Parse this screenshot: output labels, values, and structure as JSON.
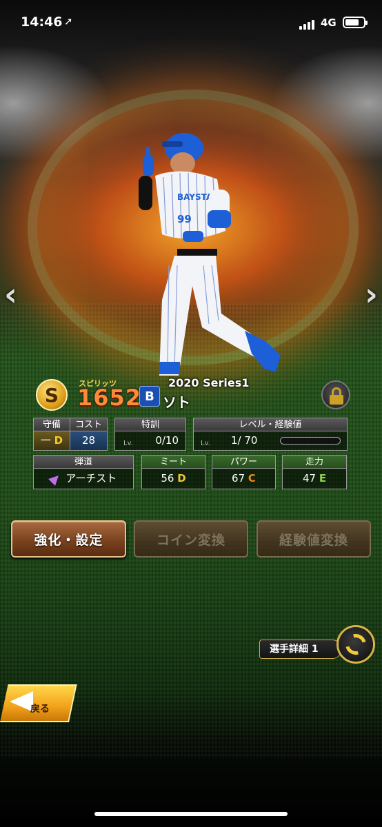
{
  "status_bar": {
    "time": "14:46",
    "network": "4G"
  },
  "card": {
    "rank_letter": "S",
    "spirits_label": "スピリッツ",
    "spirits_value": "1652",
    "team_logo_text": "B",
    "series": "2020 Series1",
    "player_name": "ソト"
  },
  "stats": {
    "defense": {
      "label": "守備",
      "position": "一",
      "grade": "D"
    },
    "cost": {
      "label": "コスト",
      "value": "28"
    },
    "training": {
      "label": "特訓",
      "lv_prefix": "Lv.",
      "value": "0/10"
    },
    "level": {
      "label": "レベル・経験値",
      "lv_prefix": "Lv.",
      "value": "1/ 70",
      "exp_fraction": 0.0
    },
    "trajectory": {
      "label": "弾道",
      "value": "アーチスト"
    },
    "meet": {
      "label": "ミート",
      "value": "56",
      "grade": "D"
    },
    "power": {
      "label": "パワー",
      "value": "67",
      "grade": "C"
    },
    "speed": {
      "label": "走力",
      "value": "47",
      "grade": "E"
    }
  },
  "buttons": {
    "enhance": "強化・設定",
    "coin": "コイン変換",
    "exp": "経験値変換",
    "detail": "選手詳細 1",
    "back": "戻る"
  },
  "icons": {
    "nav_prev": "chevron-left-icon",
    "nav_next": "chevron-right-icon",
    "lock": "lock-icon",
    "swap": "swap-icon",
    "back": "back-arrow-icon"
  }
}
